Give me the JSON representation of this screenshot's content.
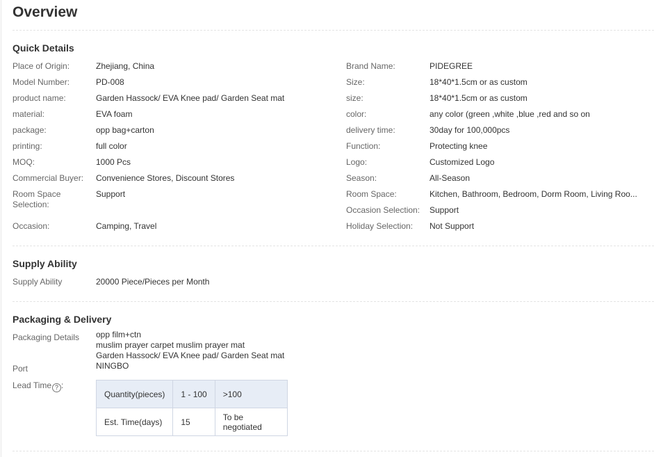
{
  "page_title": "Overview",
  "quick_details": {
    "title": "Quick Details",
    "left": [
      {
        "label": "Place of Origin:",
        "value": "Zhejiang, China"
      },
      {
        "label": "Model Number:",
        "value": "PD-008"
      },
      {
        "label": "product name:",
        "value": "Garden Hassock/ EVA Knee pad/ Garden Seat mat"
      },
      {
        "label": "material:",
        "value": "EVA foam"
      },
      {
        "label": "package:",
        "value": "opp bag+carton"
      },
      {
        "label": "printing:",
        "value": "full color"
      },
      {
        "label": "MOQ:",
        "value": "1000 Pcs"
      },
      {
        "label": "Commercial Buyer:",
        "value": "Convenience Stores, Discount Stores"
      },
      {
        "label": "Room Space Selection:",
        "value": "Support"
      },
      {
        "label": "Occasion:",
        "value": "Camping, Travel"
      }
    ],
    "right": [
      {
        "label": "Brand Name:",
        "value": "PIDEGREE"
      },
      {
        "label": "Size:",
        "value": "18*40*1.5cm or as custom"
      },
      {
        "label": "size:",
        "value": "18*40*1.5cm or as custom"
      },
      {
        "label": "color:",
        "value": "any color (green ,white ,blue ,red and so on"
      },
      {
        "label": "delivery time:",
        "value": "30day for 100,000pcs"
      },
      {
        "label": "Function:",
        "value": "Protecting knee"
      },
      {
        "label": "Logo:",
        "value": "Customized Logo"
      },
      {
        "label": "Season:",
        "value": "All-Season"
      },
      {
        "label": "Room Space:",
        "value": "Kitchen, Bathroom, Bedroom, Dorm Room, Living Roo..."
      },
      {
        "label": "Occasion Selection:",
        "value": "Support"
      },
      {
        "label": "Holiday Selection:",
        "value": "Not Support"
      }
    ]
  },
  "supply_ability": {
    "title": "Supply Ability",
    "label": "Supply Ability",
    "value": "20000 Piece/Pieces per Month"
  },
  "packaging": {
    "title": "Packaging & Delivery",
    "details_label": "Packaging Details",
    "details_lines": [
      "opp film+ctn",
      "muslim prayer carpet muslim prayer mat",
      "Garden Hassock/ EVA Knee pad/ Garden Seat mat"
    ],
    "port_label": "Port",
    "port_value": "NINGBO",
    "lead_time_label": "Lead Time",
    "lead_time_suffix": ":",
    "help_glyph": "?",
    "lead_table": {
      "header": [
        "Quantity(pieces)",
        "1 - 100",
        ">100"
      ],
      "row": [
        "Est. Time(days)",
        "15",
        "To be negotiated"
      ]
    }
  },
  "colors": {
    "table_header_bg": "#e7edf6",
    "table_border": "#cfd6e3",
    "label_text": "#666666",
    "value_text": "#333333"
  }
}
